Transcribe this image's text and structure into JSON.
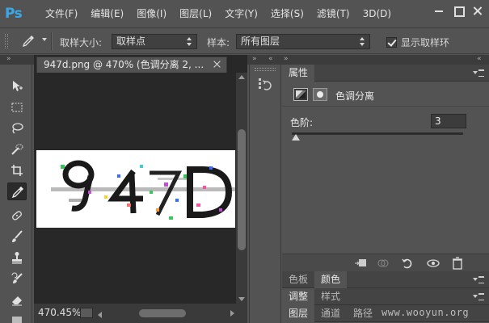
{
  "app": {
    "logo": "Ps",
    "menu": [
      "文件(F)",
      "编辑(E)",
      "图像(I)",
      "图层(L)",
      "文字(Y)",
      "选择(S)",
      "滤镜(T)",
      "3D(D)"
    ]
  },
  "options_bar": {
    "tool_icon": "eyedropper-icon",
    "sample_size_label": "取样大小:",
    "sample_size_value": "取样点",
    "sample_label": "样本:",
    "sample_value": "所有图层",
    "show_sampling_ring_label": "显示取样环",
    "show_sampling_ring_checked": true
  },
  "tools": [
    {
      "name": "move-tool",
      "icon": "move-icon"
    },
    {
      "name": "marquee-tool",
      "icon": "rect-marquee-icon"
    },
    {
      "name": "lasso-tool",
      "icon": "lasso-icon"
    },
    {
      "name": "quick-select-tool",
      "icon": "quick-select-icon"
    },
    {
      "name": "crop-tool",
      "icon": "crop-icon"
    },
    {
      "name": "eyedropper-tool",
      "icon": "eyedropper-icon",
      "active": true
    },
    {
      "name": "healing-tool",
      "icon": "bandage-icon"
    },
    {
      "name": "brush-tool",
      "icon": "brush-icon"
    },
    {
      "name": "stamp-tool",
      "icon": "stamp-icon"
    },
    {
      "name": "history-brush-tool",
      "icon": "history-brush-icon"
    },
    {
      "name": "eraser-tool",
      "icon": "eraser-icon"
    }
  ],
  "document": {
    "tab_title": "947d.png @ 470% (色调分离 2, ...",
    "zoom": "470.45%",
    "image_text": "947D"
  },
  "properties_panel": {
    "tab": "属性",
    "title": "色调分离",
    "levels_label": "色阶:",
    "levels_value": "3"
  },
  "panel_tabs_2": [
    "色板",
    "颜色"
  ],
  "panel_tabs_3": [
    "调整",
    "样式"
  ],
  "panel_tabs_4": [
    "图层",
    "通道",
    "路径"
  ],
  "watermark": "www.wooyun.org",
  "colors": {
    "ui_bg": "#535353",
    "canvas_bg": "#282828",
    "ps_blue": "#3aa8e8"
  }
}
